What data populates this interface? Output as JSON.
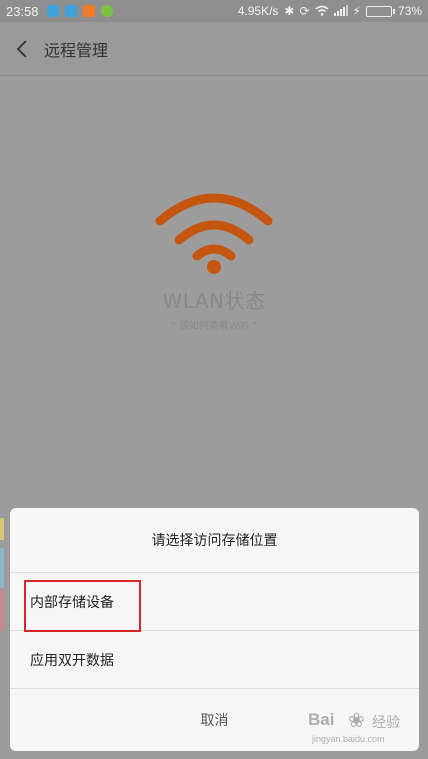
{
  "status_bar": {
    "time": "23:58",
    "network_speed": "4.95K/s",
    "battery_percent": "73%",
    "battery_level": 0.73,
    "icons": [
      "bluetooth-icon",
      "rotation-icon",
      "wifi-icon",
      "signal-icon",
      "charging-icon"
    ]
  },
  "header": {
    "back_icon": "chevron-left-icon",
    "title": "远程管理"
  },
  "wlan": {
    "title": "WLAN状态",
    "subtitle": "\" 该如何查看WiFi \"",
    "icon_color": "#c4560f"
  },
  "dialog": {
    "title": "请选择访问存储位置",
    "options": [
      {
        "label": "内部存储设备",
        "highlighted": true
      },
      {
        "label": "应用双开数据",
        "highlighted": false
      }
    ],
    "cancel_label": "取消"
  },
  "watermark": {
    "text": "Bai",
    "tail": "经验",
    "url": "jingyan.baidu.com"
  },
  "colors": {
    "highlight": "#d9262a",
    "overlay": "#9c9c9c",
    "dialog_bg": "#f6f6f6"
  }
}
